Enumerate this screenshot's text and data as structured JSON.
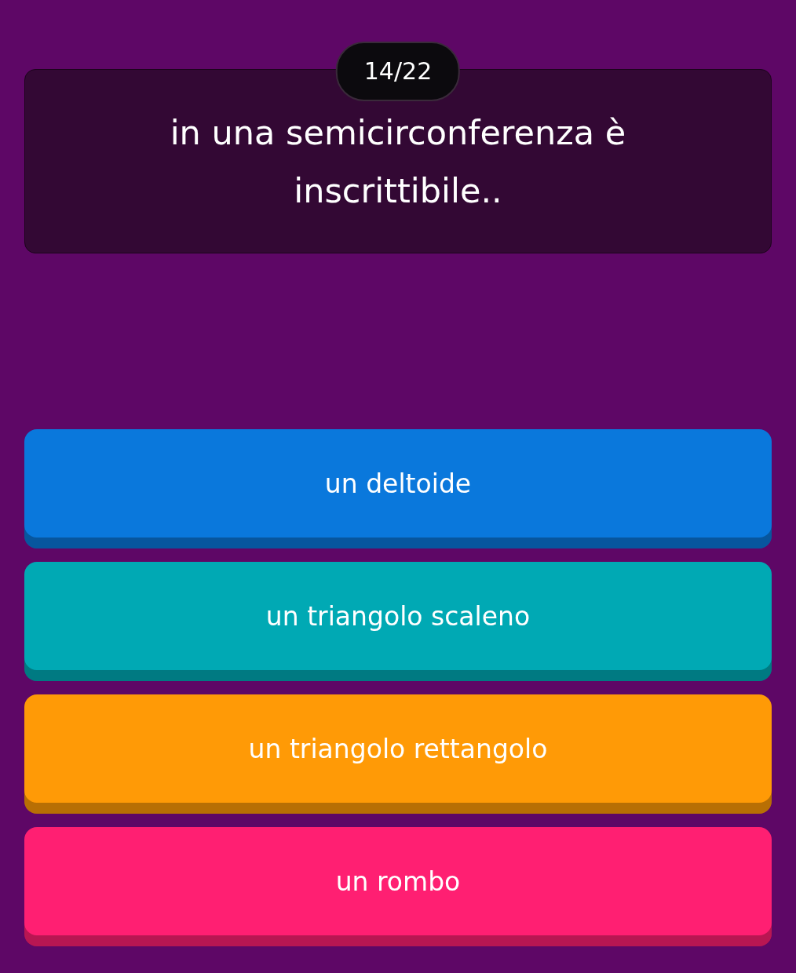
{
  "counter": "14/22",
  "question": "in una semicirconferenza è inscrittibile..",
  "answers": [
    {
      "label": "un deltoide",
      "color": "#0a78dc"
    },
    {
      "label": "un triangolo scaleno",
      "color": "#00a9b4"
    },
    {
      "label": "un triangolo rettangolo",
      "color": "#ff9a06"
    },
    {
      "label": "un rombo",
      "color": "#ff1f72"
    }
  ]
}
